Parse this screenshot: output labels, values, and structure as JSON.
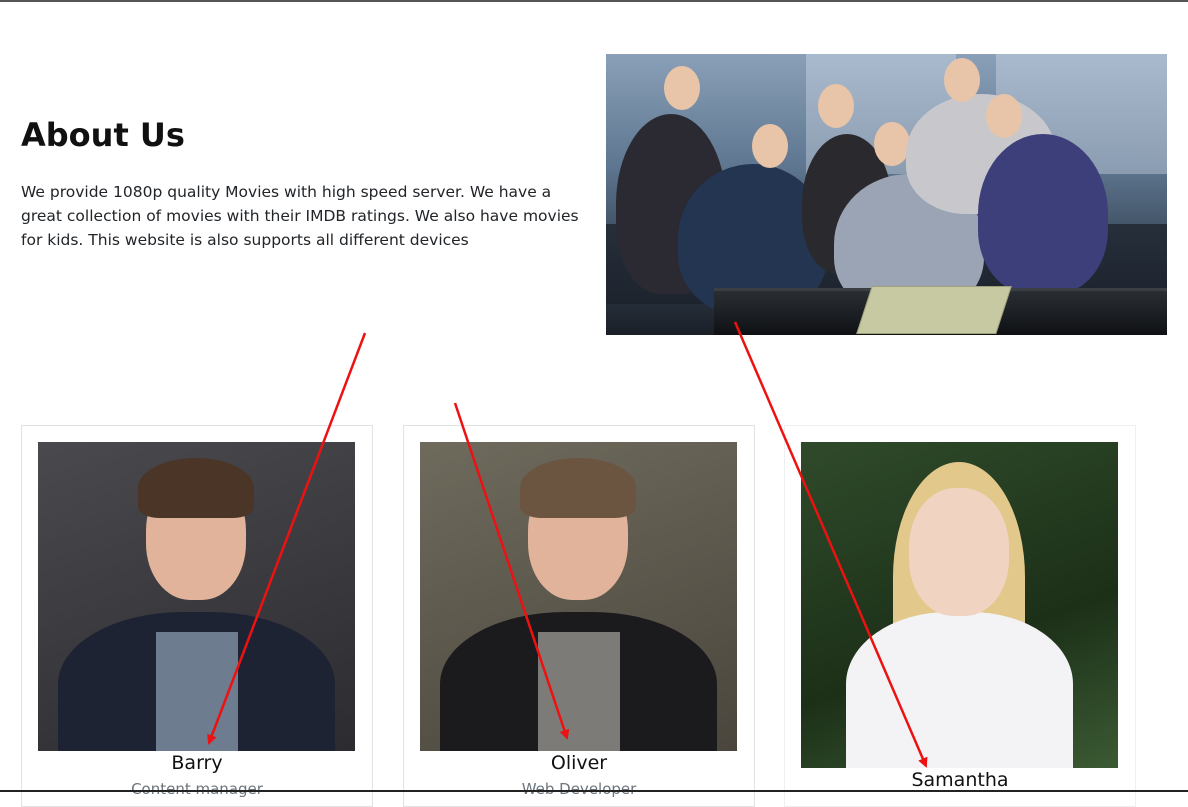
{
  "about": {
    "title": "About Us",
    "text": "We provide 1080p quality Movies with high speed server. We have a great collection of movies with their IMDB ratings. We also have movies for kids. This website is also supports all different devices"
  },
  "team": [
    {
      "name": "Barry",
      "role": "Content manager"
    },
    {
      "name": "Oliver",
      "role": "Web Developer"
    },
    {
      "name": "Samantha",
      "role": ""
    }
  ],
  "colors": {
    "annotation_arrow": "#ee1111",
    "role_text": "#6c757d",
    "card_border": "#e2e2e2"
  }
}
